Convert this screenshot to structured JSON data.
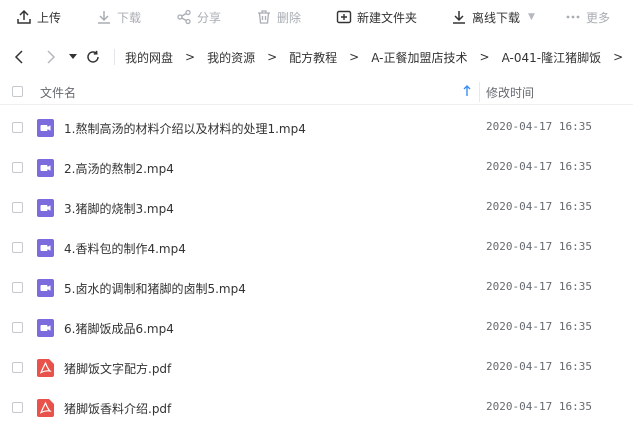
{
  "toolbar": {
    "buttons": [
      {
        "label": "上传",
        "icon": "upload-icon",
        "enabled": true
      },
      {
        "label": "下载",
        "icon": "download-icon",
        "enabled": false
      },
      {
        "label": "分享",
        "icon": "share-icon",
        "enabled": false
      },
      {
        "label": "删除",
        "icon": "trash-icon",
        "enabled": false
      },
      {
        "label": "新建文件夹",
        "icon": "new-folder-icon",
        "enabled": true
      },
      {
        "label": "离线下载",
        "icon": "offline-download-icon",
        "enabled": true
      },
      {
        "label": "更多",
        "icon": "more-icon",
        "enabled": false
      }
    ]
  },
  "breadcrumb": {
    "items": [
      "我的网盘",
      "我的资源",
      "配方教程",
      "A-正餐加盟店技术",
      "A-041-隆江猪脚饭"
    ]
  },
  "table": {
    "col_name": "文件名",
    "col_time": "修改时间",
    "rows": [
      {
        "name": "1.熬制高汤的材料介绍以及材料的处理1.mp4",
        "time": "2020-04-17 16:35",
        "type": "video"
      },
      {
        "name": "2.高汤的熬制2.mp4",
        "time": "2020-04-17 16:35",
        "type": "video"
      },
      {
        "name": "3.猪脚的烧制3.mp4",
        "time": "2020-04-17 16:35",
        "type": "video"
      },
      {
        "name": "4.香料包的制作4.mp4",
        "time": "2020-04-17 16:35",
        "type": "video"
      },
      {
        "name": "5.卤水的调制和猪脚的卤制5.mp4",
        "time": "2020-04-17 16:35",
        "type": "video"
      },
      {
        "name": "6.猪脚饭成品6.mp4",
        "time": "2020-04-17 16:35",
        "type": "video"
      },
      {
        "name": "猪脚饭文字配方.pdf",
        "time": "2020-04-17 16:35",
        "type": "pdf"
      },
      {
        "name": "猪脚饭香料介绍.pdf",
        "time": "2020-04-17 16:35",
        "type": "pdf"
      }
    ]
  },
  "colors": {
    "video_icon": "#7b6bdc",
    "pdf_icon": "#e8524a",
    "sort_arrow": "#3a8ef6",
    "disabled_text": "#a9adb3"
  }
}
